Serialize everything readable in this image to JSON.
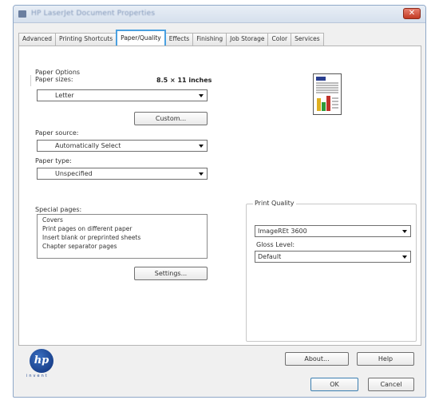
{
  "window": {
    "title": "HP LaserJet Document Properties",
    "close_label": "✕"
  },
  "tabs": [
    {
      "label": "Advanced"
    },
    {
      "label": "Printing Shortcuts"
    },
    {
      "label": "Paper/Quality"
    },
    {
      "label": "Effects"
    },
    {
      "label": "Finishing"
    },
    {
      "label": "Job Storage"
    },
    {
      "label": "Color"
    },
    {
      "label": "Services"
    }
  ],
  "paper_options": {
    "group_label": "Paper Options",
    "size_label": "Paper sizes:",
    "size_dimensions": "8.5 × 11 inches",
    "size_value": "Letter",
    "custom_label": "Custom...",
    "source_label": "Paper source:",
    "source_value": "Automatically Select",
    "type_label": "Paper type:",
    "type_value": "Unspecified"
  },
  "special_pages": {
    "label": "Special pages:",
    "items": [
      "Covers",
      "Print pages on different paper",
      "Insert blank or preprinted sheets",
      "Chapter separator pages"
    ],
    "settings_label": "Settings..."
  },
  "print_quality": {
    "group_label": "Print Quality",
    "quality_value": "ImageREt 3600",
    "gloss_label": "Gloss Level:",
    "gloss_value": "Default"
  },
  "footer": {
    "logo_text": "hp",
    "logo_tagline": "invent",
    "about_label": "About...",
    "help_label": "Help",
    "ok_label": "OK",
    "cancel_label": "Cancel"
  },
  "icons": {
    "preview": "page-preview-icon",
    "dropdown": "chevron-down-icon"
  },
  "colors": {
    "active_tab_border": "#4aa0e0",
    "close_button": "#c23a22",
    "hp_blue": "#0d2f78"
  }
}
